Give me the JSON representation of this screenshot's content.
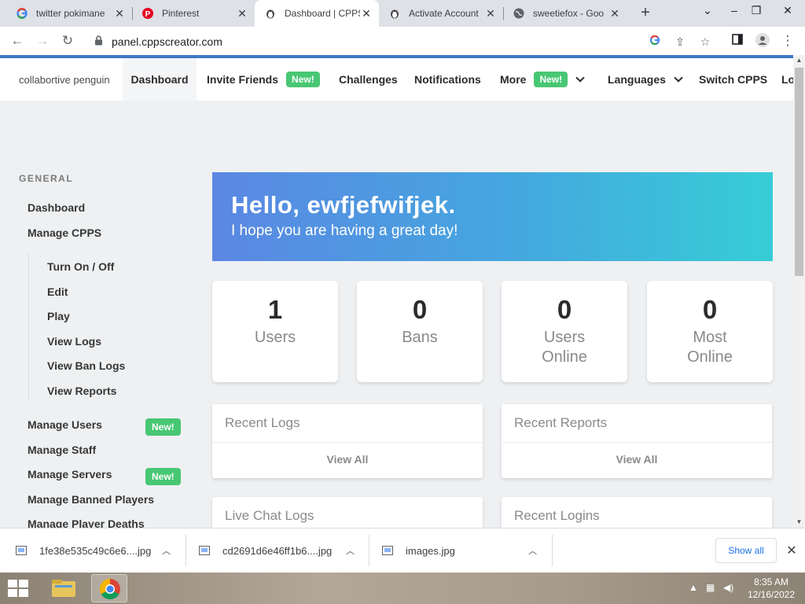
{
  "browser": {
    "tabs": [
      {
        "title": "twitter pokimane",
        "icon": "google-icon",
        "active": false
      },
      {
        "title": "Pinterest",
        "icon": "pinterest-icon",
        "active": false
      },
      {
        "title": "Dashboard | CPPS",
        "icon": "penguin-icon",
        "active": true
      },
      {
        "title": "Activate Account",
        "icon": "penguin-icon",
        "active": false
      },
      {
        "title": "sweetiefox - Goo",
        "icon": "globe-icon",
        "active": false
      }
    ],
    "url": "panel.cppscreator.com"
  },
  "topnav": {
    "brand": "collabortive penguin",
    "items": [
      {
        "label": "Dashboard"
      },
      {
        "label": "Invite Friends",
        "badge": "New!"
      },
      {
        "label": "Challenges"
      },
      {
        "label": "Notifications"
      },
      {
        "label": "More",
        "badge": "New!"
      },
      {
        "label": "Languages"
      },
      {
        "label": "Switch CPPS"
      },
      {
        "label": "Lo"
      }
    ]
  },
  "sidebar": {
    "heading": "GENERAL",
    "links": [
      {
        "label": "Dashboard"
      },
      {
        "label": "Manage CPPS"
      }
    ],
    "sub_links": [
      {
        "label": "Turn On / Off"
      },
      {
        "label": "Edit"
      },
      {
        "label": "Play"
      },
      {
        "label": "View Logs"
      },
      {
        "label": "View Ban Logs"
      },
      {
        "label": "View Reports"
      }
    ],
    "links2": [
      {
        "label": "Manage Users",
        "badge": "New!"
      },
      {
        "label": "Manage Staff"
      },
      {
        "label": "Manage Servers",
        "badge": "New!"
      },
      {
        "label": "Manage Banned Players"
      },
      {
        "label": "Manage Player Deaths"
      }
    ]
  },
  "hero": {
    "greeting": "Hello, ewfjefwifjek.",
    "subtitle": "I hope you are having a great day!"
  },
  "stats": [
    {
      "value": "1",
      "label": "Users"
    },
    {
      "value": "0",
      "label": "Bans"
    },
    {
      "value": "0",
      "label": "Users Online"
    },
    {
      "value": "0",
      "label": "Most Online"
    }
  ],
  "panels": [
    {
      "title": "Recent Logs",
      "footer": "View All"
    },
    {
      "title": "Recent Reports",
      "footer": "View All"
    },
    {
      "title": "Live Chat Logs"
    },
    {
      "title": "Recent Logins"
    }
  ],
  "downloads": {
    "items": [
      {
        "name": "1fe38e535c49c6e6....jpg"
      },
      {
        "name": "cd2691d6e46ff1b6....jpg"
      },
      {
        "name": "images.jpg"
      }
    ],
    "show_all": "Show all"
  },
  "taskbar": {
    "time": "8:35 AM",
    "date": "12/16/2022"
  },
  "colors": {
    "accent_green": "#48c774",
    "hero_start": "#5b87e3",
    "hero_end": "#36cdd6",
    "browser_accent": "#3d78c8"
  }
}
